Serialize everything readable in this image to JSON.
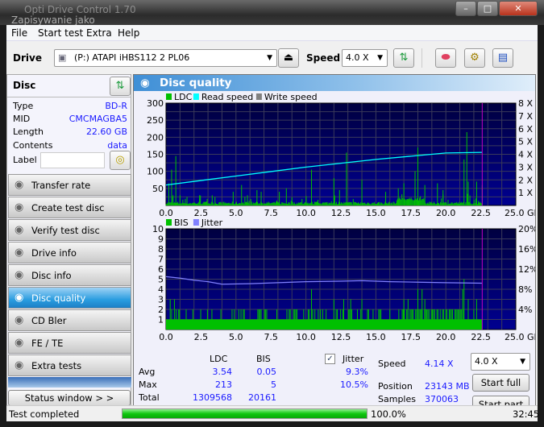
{
  "window": {
    "title": "Opti Drive Control 1.70",
    "behind_title": "Zapisywanie jako",
    "controls": [
      "minimize",
      "maximize",
      "close"
    ]
  },
  "menu": [
    "File",
    "Start test",
    "Extra",
    "Help"
  ],
  "toolbar": {
    "drive_label": "Drive",
    "drive_value": "(P:)   ATAPI iHBS112   2 PL06",
    "speed_label": "Speed",
    "speed_value": "4.0 X",
    "icons": [
      "refresh-icon",
      "eraser-icon",
      "settings-icon",
      "save-icon"
    ]
  },
  "disc": {
    "header": "Disc",
    "rows": [
      {
        "k": "Type",
        "v": "BD-R"
      },
      {
        "k": "MID",
        "v": "CMCMAGBA5"
      },
      {
        "k": "Length",
        "v": "22.60 GB"
      },
      {
        "k": "Contents",
        "v": "data"
      }
    ],
    "label_key": "Label",
    "label_value": ""
  },
  "nav": [
    {
      "label": "Transfer rate"
    },
    {
      "label": "Create test disc"
    },
    {
      "label": "Verify test disc"
    },
    {
      "label": "Drive info"
    },
    {
      "label": "Disc info"
    },
    {
      "label": "Disc quality",
      "selected": true
    },
    {
      "label": "CD Bler"
    },
    {
      "label": "FE / TE"
    },
    {
      "label": "Extra tests"
    }
  ],
  "status_window_label": "Status window > >",
  "panel_title": "Disc quality",
  "colors": {
    "ldc": "#00c000",
    "read_speed": "#00ffff",
    "write_speed": "#808080",
    "bis": "#00c000",
    "jitter": "#8080ff",
    "plot_bg": "#000080",
    "end_marker": "#c000c0"
  },
  "chart_data": [
    {
      "type": "bar",
      "legend": [
        "LDC",
        "Read speed",
        "Write speed"
      ],
      "xlim": [
        0,
        25
      ],
      "ylim": [
        0,
        300
      ],
      "y2lim": [
        0,
        8
      ],
      "x_ticks": [
        "0.0",
        "2.5",
        "5.0",
        "7.5",
        "10.0",
        "12.5",
        "15.0",
        "17.5",
        "20.0",
        "22.5",
        "25.0 GB"
      ],
      "y_ticks": [
        "300",
        "250",
        "200",
        "150",
        "100",
        "50"
      ],
      "y2_ticks": [
        "8 X",
        "7 X",
        "6 X",
        "5 X",
        "4 X",
        "3 X",
        "2 X",
        "1 X"
      ],
      "ldc_spikes": [
        [
          0.2,
          65
        ],
        [
          0.4,
          105
        ],
        [
          0.5,
          30
        ],
        [
          0.7,
          145
        ],
        [
          1.0,
          30
        ],
        [
          1.5,
          25
        ],
        [
          2.4,
          30
        ],
        [
          3.5,
          25
        ],
        [
          4.8,
          40
        ],
        [
          5.4,
          60
        ],
        [
          6.5,
          45
        ],
        [
          6.8,
          40
        ],
        [
          8.1,
          40
        ],
        [
          8.6,
          50
        ],
        [
          10.4,
          105
        ],
        [
          12.0,
          80
        ],
        [
          12.4,
          45
        ],
        [
          12.9,
          155
        ],
        [
          14.0,
          75
        ],
        [
          15.7,
          40
        ],
        [
          16.6,
          50
        ],
        [
          17.0,
          65
        ],
        [
          17.8,
          100
        ],
        [
          18.0,
          170
        ],
        [
          18.5,
          60
        ],
        [
          19.4,
          65
        ],
        [
          19.8,
          45
        ],
        [
          21.3,
          135
        ],
        [
          21.5,
          215
        ],
        [
          21.6,
          70
        ],
        [
          22.2,
          70
        ],
        [
          22.6,
          60
        ]
      ],
      "read_speed": [
        [
          0,
          1.6
        ],
        [
          2.5,
          1.95
        ],
        [
          5,
          2.3
        ],
        [
          7.5,
          2.65
        ],
        [
          10,
          3.0
        ],
        [
          12.5,
          3.3
        ],
        [
          15,
          3.6
        ],
        [
          17.5,
          3.85
        ],
        [
          20,
          4.1
        ],
        [
          22.6,
          4.15
        ]
      ],
      "end_gb": 22.6
    },
    {
      "type": "bar",
      "legend": [
        "BIS",
        "Jitter"
      ],
      "xlim": [
        0,
        25
      ],
      "ylim": [
        0,
        10
      ],
      "y2lim": [
        0,
        20
      ],
      "x_ticks": [
        "0.0",
        "2.5",
        "5.0",
        "7.5",
        "10.0",
        "12.5",
        "15.0",
        "17.5",
        "20.0",
        "22.5",
        "25.0 GB"
      ],
      "y_ticks": [
        "10",
        "9",
        "8",
        "7",
        "6",
        "5",
        "4",
        "3",
        "2",
        "1"
      ],
      "y2_ticks": [
        "20%",
        "16%",
        "12%",
        "8%",
        "4%"
      ],
      "bis_spikes": [
        [
          0.3,
          3
        ],
        [
          0.6,
          3
        ],
        [
          10.4,
          4
        ],
        [
          12.0,
          3
        ],
        [
          12.7,
          3
        ],
        [
          13.2,
          3
        ],
        [
          14.0,
          3
        ],
        [
          17.0,
          3
        ],
        [
          17.3,
          3
        ],
        [
          18.0,
          4
        ],
        [
          18.3,
          4
        ],
        [
          18.5,
          3
        ],
        [
          21.2,
          4
        ],
        [
          21.3,
          5
        ],
        [
          21.6,
          3
        ],
        [
          22.2,
          3
        ]
      ],
      "jitter": [
        [
          0,
          10.5
        ],
        [
          1,
          10.2
        ],
        [
          2,
          9.8
        ],
        [
          3,
          9.5
        ],
        [
          4,
          9.0
        ],
        [
          6,
          9.1
        ],
        [
          8,
          9.3
        ],
        [
          10,
          9.5
        ],
        [
          12.5,
          9.6
        ],
        [
          14,
          9.7
        ],
        [
          16,
          9.5
        ],
        [
          18,
          9.4
        ],
        [
          20,
          9.3
        ],
        [
          22.6,
          9.2
        ]
      ]
    }
  ],
  "stats": {
    "headers": [
      "LDC",
      "BIS"
    ],
    "jitter_label": "Jitter",
    "jitter_checked": true,
    "rows": [
      {
        "label": "Avg",
        "ldc": "3.54",
        "bis": "0.05",
        "jitter": "9.3%"
      },
      {
        "label": "Max",
        "ldc": "213",
        "bis": "5",
        "jitter": "10.5%"
      },
      {
        "label": "Total",
        "ldc": "1309568",
        "bis": "20161",
        "jitter": ""
      }
    ],
    "speed_label": "Speed",
    "speed_value": "4.14 X",
    "position_label": "Position",
    "position_value": "23143 MB",
    "samples_label": "Samples",
    "samples_value": "370063",
    "speed_select": "4.0 X",
    "start_full": "Start full",
    "start_part": "Start part"
  },
  "statusbar": {
    "text": "Test completed",
    "progress_pct": 100,
    "progress_text": "100.0%",
    "time": "32:45"
  }
}
